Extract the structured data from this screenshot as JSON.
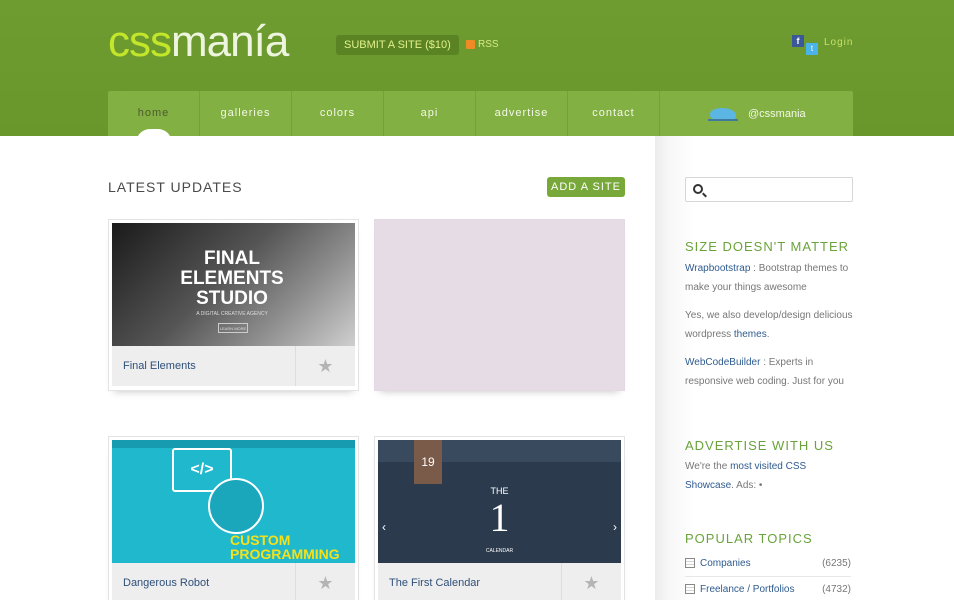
{
  "header": {
    "logo_css": "css",
    "logo_mania": "manía",
    "submit_label": "SUBMIT A SITE ($10)",
    "rss_label": "RSS",
    "login_label": "Login",
    "twitter_handle": "@cssmania",
    "nav": [
      {
        "label": "home"
      },
      {
        "label": "galleries"
      },
      {
        "label": "colors"
      },
      {
        "label": "api"
      },
      {
        "label": "advertise"
      },
      {
        "label": "contact"
      }
    ]
  },
  "main": {
    "title": "LATEST UPDATES",
    "add_site_label": "ADD A SITE",
    "cards": [
      {
        "title": "Final Elements",
        "thumb_line1": "FINAL",
        "thumb_line2": "ELEMENTS",
        "thumb_line3": "STUDIO",
        "thumb_sub": "A DIGITAL CREATIVE AGENCY",
        "thumb_btn": "LEARN MORE"
      },
      {
        "title": "Dangerous Robot",
        "thumb_symbol": "</>",
        "thumb_text": "CUSTOM PROGRAMMING"
      },
      {
        "title": "The First Calendar",
        "thumb_date": "19",
        "thumb_the": "THE",
        "thumb_one": "1",
        "thumb_cal": "CALENDAR"
      }
    ]
  },
  "sidebar": {
    "search_placeholder": "",
    "size_title": "SIZE DOESN'T MATTER",
    "wrap_link": "Wrapbootstrap",
    "wrap_text": " : Bootstrap themes to make your things awesome",
    "wp_text": "Yes, we also develop/design delicious wordpress ",
    "wp_link": "themes",
    "wp_end": ".",
    "wcb_link": "WebCodeBuilder",
    "wcb_text": " : Experts in responsive web coding. Just for you",
    "advertise_title": "ADVERTISE WITH US",
    "adv_text1": "We're the ",
    "adv_link": "most visited CSS Showcase",
    "adv_text2": ". Ads: •",
    "topics_title": "POPULAR TOPICS",
    "topics": [
      {
        "label": "Companies",
        "count": "(6235)"
      },
      {
        "label": "Freelance / Portfolios",
        "count": "(4732)"
      }
    ]
  },
  "colors": {
    "header_green": "#6b9a2d",
    "nav_green": "#82b043",
    "accent_green": "#78a83a",
    "link_blue": "#2f5b8f"
  }
}
